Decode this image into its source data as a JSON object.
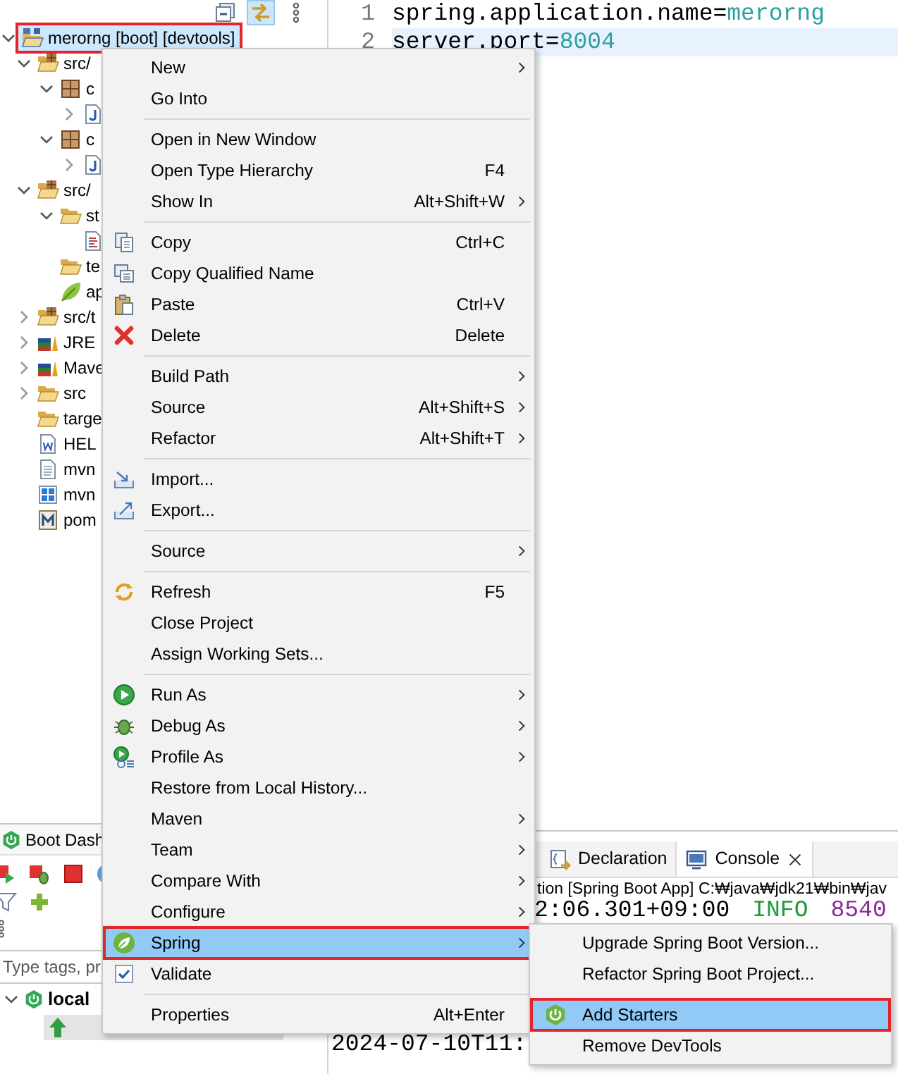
{
  "explorer": {
    "toolbar": [
      {
        "kind": "collapse",
        "on": false
      },
      {
        "kind": "link",
        "on": true
      },
      {
        "kind": "more",
        "on": false
      }
    ],
    "tree": [
      {
        "kind": "project",
        "label": "merorng [boot] [devtools]",
        "expanded": true,
        "selected": true,
        "outlined": true,
        "children": [
          {
            "kind": "srcfolder",
            "label": "src/",
            "expanded": true,
            "selected": false,
            "outlined": false,
            "children": [
              {
                "kind": "package",
                "label": "c",
                "expanded": true,
                "selected": false,
                "outlined": false,
                "children": [
                  {
                    "kind": "java",
                    "expanded": false,
                    "selected": false,
                    "outlined": false
                  }
                ]
              },
              {
                "kind": "package",
                "label": "c",
                "expanded": true,
                "selected": false,
                "outlined": false,
                "children": [
                  {
                    "kind": "java",
                    "expanded": false,
                    "selected": false,
                    "outlined": false
                  }
                ]
              }
            ]
          },
          {
            "kind": "srcfolder",
            "label": "src/",
            "expanded": true,
            "selected": false,
            "outlined": false,
            "children": [
              {
                "kind": "folder",
                "label": "st",
                "expanded": true,
                "selected": false,
                "outlined": false,
                "children": [
                  {
                    "kind": "textfile",
                    "selected": false,
                    "outlined": false
                  }
                ]
              },
              {
                "kind": "folder",
                "label": "te",
                "selected": false,
                "outlined": false
              },
              {
                "kind": "leaf",
                "label": "ap",
                "selected": false,
                "outlined": false
              }
            ]
          },
          {
            "kind": "srcfolder",
            "label": "src/t",
            "expanded": false,
            "selected": false,
            "outlined": false
          },
          {
            "kind": "library",
            "label": "JRE",
            "expanded": false,
            "selected": false,
            "outlined": false
          },
          {
            "kind": "library",
            "label": "Mave",
            "expanded": false,
            "selected": false,
            "outlined": false
          },
          {
            "kind": "folder",
            "label": "src",
            "expanded": false,
            "selected": false,
            "outlined": false
          },
          {
            "kind": "folder",
            "label": "targe",
            "selected": false,
            "outlined": false
          },
          {
            "kind": "wordfile",
            "label": "HEL",
            "selected": false,
            "outlined": false
          },
          {
            "kind": "file",
            "label": "mvn",
            "selected": false,
            "outlined": false
          },
          {
            "kind": "cmdfile",
            "label": "mvn",
            "selected": false,
            "outlined": false
          },
          {
            "kind": "pom",
            "label": "pom",
            "selected": false,
            "outlined": false
          }
        ]
      }
    ]
  },
  "boot_dashboard": {
    "tab": "Boot Dash",
    "search": {
      "placeholder": "Type tags, pr"
    },
    "tree": [
      {
        "label": "local",
        "expanded": true,
        "selected": false,
        "children": [
          {
            "selected": true
          }
        ]
      }
    ]
  },
  "editor": {
    "lines": [
      {
        "number": "1",
        "key": "spring.application.name",
        "separator": "=",
        "value": "merorng",
        "current": false
      },
      {
        "number": "2",
        "key": "server.port",
        "separator": "=",
        "value": "8004",
        "current": true
      }
    ]
  },
  "console": {
    "tabs": [
      {
        "label": "Declaration",
        "selected": false,
        "closable": false
      },
      {
        "label": "Console",
        "selected": true,
        "closable": true
      }
    ],
    "description": "tion [Spring Boot App] C:₩java₩jdk21₩bin₩jav",
    "lines": [
      {
        "segments": [
          {
            "kind": "time",
            "text": "2:06.301+09:00"
          },
          {
            "kind": "level",
            "text": "INFO"
          },
          {
            "kind": "pid",
            "text": "8540"
          }
        ]
      },
      {
        "segments": [
          {
            "kind": "time",
            "text": "2024-07-10T11:"
          }
        ]
      }
    ]
  },
  "context_menu": {
    "items": [
      {
        "kind": "plain",
        "label": "New",
        "submenu": true,
        "selected": false,
        "outlined": false
      },
      {
        "kind": "plain",
        "label": "Go Into",
        "submenu": false,
        "selected": false,
        "outlined": false
      },
      {
        "kind": "separator"
      },
      {
        "kind": "plain",
        "label": "Open in New Window",
        "submenu": false,
        "selected": false,
        "outlined": false
      },
      {
        "kind": "plain",
        "label": "Open Type Hierarchy",
        "shortcut": "F4",
        "submenu": false,
        "selected": false,
        "outlined": false
      },
      {
        "kind": "plain",
        "label": "Show In",
        "shortcut": "Alt+Shift+W",
        "submenu": true,
        "selected": false,
        "outlined": false
      },
      {
        "kind": "separator"
      },
      {
        "kind": "copy",
        "label": "Copy",
        "shortcut": "Ctrl+C",
        "submenu": false,
        "selected": false,
        "outlined": false
      },
      {
        "kind": "copy-name",
        "label": "Copy Qualified Name",
        "submenu": false,
        "selected": false,
        "outlined": false
      },
      {
        "kind": "paste",
        "label": "Paste",
        "shortcut": "Ctrl+V",
        "submenu": false,
        "selected": false,
        "outlined": false
      },
      {
        "kind": "delete",
        "label": "Delete",
        "shortcut": "Delete",
        "submenu": false,
        "selected": false,
        "outlined": false
      },
      {
        "kind": "separator"
      },
      {
        "kind": "plain",
        "label": "Build Path",
        "submenu": true,
        "selected": false,
        "outlined": false
      },
      {
        "kind": "plain",
        "label": "Source",
        "shortcut": "Alt+Shift+S",
        "submenu": true,
        "selected": false,
        "outlined": false
      },
      {
        "kind": "plain",
        "label": "Refactor",
        "shortcut": "Alt+Shift+T",
        "submenu": true,
        "selected": false,
        "outlined": false
      },
      {
        "kind": "separator"
      },
      {
        "kind": "import",
        "label": "Import...",
        "submenu": false,
        "selected": false,
        "outlined": false
      },
      {
        "kind": "export",
        "label": "Export...",
        "submenu": false,
        "selected": false,
        "outlined": false
      },
      {
        "kind": "separator"
      },
      {
        "kind": "plain",
        "label": "Source",
        "submenu": true,
        "selected": false,
        "outlined": false
      },
      {
        "kind": "separator"
      },
      {
        "kind": "refresh",
        "label": "Refresh",
        "shortcut": "F5",
        "submenu": false,
        "selected": false,
        "outlined": false
      },
      {
        "kind": "plain",
        "label": "Close Project",
        "submenu": false,
        "selected": false,
        "outlined": false
      },
      {
        "kind": "plain",
        "label": "Assign Working Sets...",
        "submenu": false,
        "selected": false,
        "outlined": false
      },
      {
        "kind": "separator"
      },
      {
        "kind": "run",
        "label": "Run As",
        "submenu": true,
        "selected": false,
        "outlined": false
      },
      {
        "kind": "debug",
        "label": "Debug As",
        "submenu": true,
        "selected": false,
        "outlined": false
      },
      {
        "kind": "profile",
        "label": "Profile As",
        "submenu": true,
        "selected": false,
        "outlined": false
      },
      {
        "kind": "plain",
        "label": "Restore from Local History...",
        "submenu": false,
        "selected": false,
        "outlined": false
      },
      {
        "kind": "plain",
        "label": "Maven",
        "submenu": true,
        "selected": false,
        "outlined": false
      },
      {
        "kind": "plain",
        "label": "Team",
        "submenu": true,
        "selected": false,
        "outlined": false
      },
      {
        "kind": "plain",
        "label": "Compare With",
        "submenu": true,
        "selected": false,
        "outlined": false
      },
      {
        "kind": "plain",
        "label": "Configure",
        "submenu": true,
        "selected": false,
        "outlined": false
      },
      {
        "kind": "spring",
        "label": "Spring",
        "submenu": true,
        "selected": true,
        "outlined": true
      },
      {
        "kind": "validate",
        "label": "Validate",
        "submenu": false,
        "selected": false,
        "outlined": false
      },
      {
        "kind": "separator"
      },
      {
        "kind": "plain",
        "label": "Properties",
        "shortcut": "Alt+Enter",
        "submenu": false,
        "selected": false,
        "outlined": false
      }
    ]
  },
  "submenu": {
    "items": [
      {
        "kind": "plain",
        "label": "Upgrade Spring Boot Version...",
        "selected": false,
        "outlined": false
      },
      {
        "kind": "plain",
        "label": "Refactor Spring Boot Project...",
        "selected": false,
        "outlined": false
      },
      {
        "kind": "boot",
        "label": "Add Starters",
        "selected": true,
        "outlined": true
      },
      {
        "kind": "plain",
        "label": "Remove DevTools",
        "selected": false,
        "outlined": false
      }
    ]
  }
}
